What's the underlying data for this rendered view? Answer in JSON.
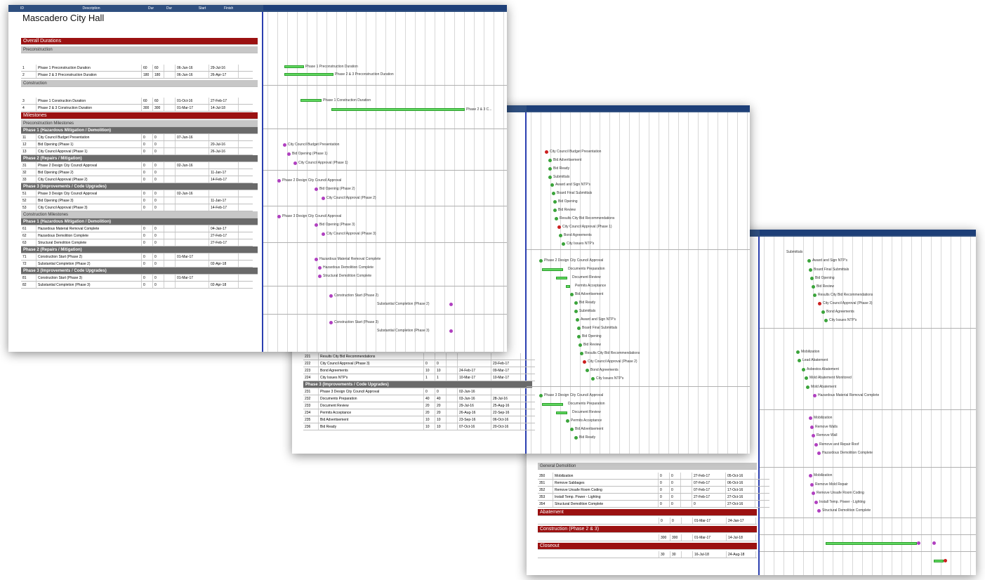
{
  "sheet1": {
    "title": "Mascadero City Hall",
    "headers": [
      "ID",
      "Description",
      "Dur",
      "Dur",
      "Start",
      "Finish"
    ],
    "sections": {
      "overall": "Overall Durations",
      "precon": "Preconstruction",
      "construction": "Construction",
      "milestones": "Milestones",
      "precon_milestones": "Preconstruction Milestones",
      "p1_sub": "Phase 1 (Hazardous Mitigation / Demolition)",
      "p2_sub": "Phase 2 (Repairs / Mitigation)",
      "p3_sub": "Phase 3 (Improvements / Code Upgrades)",
      "cons_milestones": "Construction Milestones",
      "p1b_sub": "Phase 1 (Hazardous Mitigation / Demolition)",
      "p2b_sub": "Phase 2 (Repairs / Mitigation)",
      "p3b_sub": "Phase 3 (Improvements / Code Upgrades)"
    },
    "rows_precon": [
      {
        "id": "1",
        "desc": "Phase 1 Preconstruction Duration",
        "d1": "60",
        "d2": "60",
        "start": "06-Jun-16",
        "finish": "29-Jul-16"
      },
      {
        "id": "2",
        "desc": "Phase 2 & 3 Preconstruction Duration",
        "d1": "180",
        "d2": "180",
        "start": "06-Jun-16",
        "finish": "26-Apr-17"
      }
    ],
    "rows_construction": [
      {
        "id": "3",
        "desc": "Phase 1 Construction Duration",
        "d1": "60",
        "d2": "60",
        "start": "01-Oct-16",
        "finish": "27-Feb-17"
      },
      {
        "id": "4",
        "desc": "Phase 2 & 3 Construction Duration",
        "d1": "300",
        "d2": "300",
        "start": "01-Mar-17",
        "finish": "14-Jul-18"
      }
    ],
    "rows_p1": [
      {
        "id": "11",
        "desc": "City Council Budget Presentation",
        "d1": "0",
        "d2": "0",
        "start": "07-Jun-16",
        "finish": ""
      },
      {
        "id": "12",
        "desc": "Bid Opening (Phase 1)",
        "d1": "0",
        "d2": "0",
        "start": "",
        "finish": "20-Jul-16"
      },
      {
        "id": "13",
        "desc": "City Council Approval (Phase 1)",
        "d1": "0",
        "d2": "0",
        "start": "",
        "finish": "26-Jul-16"
      }
    ],
    "rows_p2": [
      {
        "id": "31",
        "desc": "Phase 2 Design City Council Approval",
        "d1": "0",
        "d2": "0",
        "start": "02-Jun-16",
        "finish": ""
      },
      {
        "id": "32",
        "desc": "Bid Opening (Phase 2)",
        "d1": "0",
        "d2": "0",
        "start": "",
        "finish": "11-Jan-17"
      },
      {
        "id": "33",
        "desc": "City Council Approval (Phase 2)",
        "d1": "0",
        "d2": "0",
        "start": "",
        "finish": "14-Feb-17"
      }
    ],
    "rows_p3": [
      {
        "id": "51",
        "desc": "Phase 3 Design City Council Approval",
        "d1": "0",
        "d2": "0",
        "start": "02-Jun-16",
        "finish": ""
      },
      {
        "id": "52",
        "desc": "Bid Opening (Phase 3)",
        "d1": "0",
        "d2": "0",
        "start": "",
        "finish": "11-Jan-17"
      },
      {
        "id": "53",
        "desc": "City Council Approval (Phase 3)",
        "d1": "0",
        "d2": "0",
        "start": "",
        "finish": "14-Feb-17"
      }
    ],
    "rows_p1b": [
      {
        "id": "61",
        "desc": "Hazardous Material Removal Complete",
        "d1": "0",
        "d2": "0",
        "start": "",
        "finish": "04-Jan-17"
      },
      {
        "id": "62",
        "desc": "Hazardous Demolition Complete",
        "d1": "0",
        "d2": "0",
        "start": "",
        "finish": "27-Feb-17"
      },
      {
        "id": "63",
        "desc": "Structural Demolition Complete",
        "d1": "0",
        "d2": "0",
        "start": "",
        "finish": "27-Feb-17"
      }
    ],
    "rows_p2b": [
      {
        "id": "71",
        "desc": "Construction Start (Phase 2)",
        "d1": "0",
        "d2": "0",
        "start": "01-Mar-17",
        "finish": ""
      },
      {
        "id": "72",
        "desc": "Substantial Completion (Phase 2)",
        "d1": "0",
        "d2": "0",
        "start": "",
        "finish": "02-Apr-18"
      }
    ],
    "rows_p3b": [
      {
        "id": "81",
        "desc": "Construction Start (Phase 3)",
        "d1": "0",
        "d2": "0",
        "start": "01-Mar-17",
        "finish": ""
      },
      {
        "id": "82",
        "desc": "Substantial Completion (Phase 3)",
        "d1": "0",
        "d2": "0",
        "start": "",
        "finish": "02-Apr-18"
      }
    ],
    "gantt_labels": {
      "b1": "Phase 1 Preconstruction Duration",
      "b2": "Phase 2 & 3 Preconstruction Duration",
      "b3": "Phase 1 Construction Duration",
      "b4": "Phase 2 & 3 C...",
      "m11": "City Council Budget Presentation",
      "m12": "Bid Opening (Phase 1)",
      "m13": "City Council Approval (Phase 1)",
      "m31": "Phase 2 Design City Council Approval",
      "m32": "Bid Opening (Phase 2)",
      "m33": "City Council Approval (Phase 2)",
      "m51": "Phase 3 Design City Council Approval",
      "m52": "Bid Opening (Phase 3)",
      "m53": "City Council Approval (Phase 3)",
      "m61": "Hazardous Material Removal Complete",
      "m62": "Hazardous Demolition Complete",
      "m63": "Structural Demolition Complete",
      "m71": "Construction Start (Phase 2)",
      "m72": "Substantial Completion (Phase 2)",
      "m81": "Construction Start (Phase 3)",
      "m82": "Substantial Completion (Phase 3)"
    }
  },
  "sheet2": {
    "subheader": "Phase 3 (Improvements / Code Upgrades)",
    "rows_top": [
      {
        "id": "221",
        "desc": "Results City Bid Recommendations",
        "d1": "",
        "d2": "",
        "start": "",
        "finish": ""
      },
      {
        "id": "222",
        "desc": "City Council Approval (Phase 3)",
        "d1": "0",
        "d2": "0",
        "start": "",
        "finish": "23-Feb-17"
      },
      {
        "id": "223",
        "desc": "Bond Agreements",
        "d1": "10",
        "d2": "10",
        "start": "24-Feb-17",
        "finish": "09-Mar-17"
      },
      {
        "id": "224",
        "desc": "City Issues NTP's",
        "d1": "1",
        "d2": "1",
        "start": "10-Mar-17",
        "finish": "10-Mar-17"
      }
    ],
    "rows_bottom": [
      {
        "id": "231",
        "desc": "Phase 3 Design City Council Approval",
        "d1": "0",
        "d2": "0",
        "start": "02-Jun-16",
        "finish": ""
      },
      {
        "id": "232",
        "desc": "Documents Preparation",
        "d1": "40",
        "d2": "40",
        "start": "03-Jun-16",
        "finish": "28-Jul-16"
      },
      {
        "id": "233",
        "desc": "Document Review",
        "d1": "20",
        "d2": "20",
        "start": "29-Jul-16",
        "finish": "25-Aug-16"
      },
      {
        "id": "234",
        "desc": "Permits Acceptance",
        "d1": "20",
        "d2": "20",
        "start": "26-Aug-16",
        "finish": "22-Sep-16"
      },
      {
        "id": "235",
        "desc": "Bid Advertisement",
        "d1": "10",
        "d2": "10",
        "start": "23-Sep-16",
        "finish": "06-Oct-16"
      },
      {
        "id": "236",
        "desc": "Bid Ready",
        "d1": "10",
        "d2": "10",
        "start": "07-Oct-16",
        "finish": "20-Oct-16"
      }
    ],
    "gantt_labels": [
      "City Council Budget Presentation",
      "Bid Advertisement",
      "Bid Ready",
      "Submittals",
      "Award and Sign NTP's",
      "Board Final Submittals",
      "Bid Opening",
      "Bid Review",
      "Results City Bid Recommendations",
      "City Council Approval (Phase 1)",
      "Bond Agreements",
      "City Issues NTP's",
      "Phase 2 Design City Council Approval",
      "Documents Preparation",
      "Document Review",
      "Permits Acceptance",
      "Bid Advertisement",
      "Bid Ready",
      "Submittals",
      "Award and Sign NTP's",
      "Board Final Submittals",
      "Bid Opening",
      "Bid Review",
      "Results City Bid Recommendations",
      "City Council Approval (Phase 2)",
      "Bond Agreements",
      "City Issues NTP's",
      "Phase 3 Design City Council Approval",
      "Documents Preparation",
      "Document Review",
      "Permits Acceptance",
      "Bid Advertisement",
      "Bid Ready"
    ]
  },
  "sheet3": {
    "sections": {
      "general": "General Demolition",
      "abatement": "Abatement",
      "construction": "Construction (Phase 2 & 3)",
      "closeout": "Closeout"
    },
    "rows_general": [
      {
        "id": "350",
        "desc": "Mobilization",
        "d1": "0",
        "d2": "0",
        "start": "27-Feb-17",
        "finish": "05-Oct-16"
      },
      {
        "id": "351",
        "desc": "Remove Sabbages",
        "d1": "0",
        "d2": "0",
        "start": "07-Feb-17",
        "finish": "06-Oct-16"
      },
      {
        "id": "352",
        "desc": "Remove Unsafe Room Coding",
        "d1": "0",
        "d2": "0",
        "start": "07-Feb-17",
        "finish": "17-Oct-16"
      },
      {
        "id": "353",
        "desc": "Install Temp. Power - Lighting",
        "d1": "0",
        "d2": "0",
        "start": "27-Feb-17",
        "finish": "27-Oct-16"
      },
      {
        "id": "354",
        "desc": "Structural Demolition Complete",
        "d1": "0",
        "d2": "0",
        "start": "0",
        "finish": "27-Oct-16"
      }
    ],
    "abatement_row": {
      "d1": "0",
      "d2": "0",
      "start": "01-Mar-17",
      "finish": "24-Jan-17"
    },
    "construction_row": {
      "d1": "300",
      "d2": "300",
      "start": "01-Mar-17",
      "finish": "14-Jul-18"
    },
    "closeout_row": {
      "d1": "30",
      "d2": "30",
      "start": "16-Jul-18",
      "finish": "24-Aug-18"
    },
    "gantt_labels": [
      "Submittals",
      "Award and Sign NTP's",
      "Board Final Submittals",
      "Bid Opening",
      "Bid Review",
      "Results City Bid Recommendations",
      "City Council Approval (Phase 3)",
      "Bond Agreements",
      "City Issues NTP's",
      "Mobilization",
      "Lead Abatement",
      "Asbestos Abatement",
      "Mold Abatement Monitored",
      "Mold Abatement",
      "Hazardous Material Removal Complete",
      "Mobilization",
      "Remove Walls",
      "Remove Wall",
      "Remove and Repair Roof",
      "Hazardous Demolition Complete",
      "Mobilization",
      "Remove Mold Repair",
      "Remove Unsafe Room Coding",
      "Install Temp. Power - Lighting",
      "Structural Demolition Complete"
    ]
  },
  "colors": {
    "header_blue": "#2f4f7f",
    "section_red": "#9b1111",
    "bar_green": "#5fd75f",
    "milestone_purple": "#b040c0",
    "milestone_red": "#cc1f1f"
  }
}
